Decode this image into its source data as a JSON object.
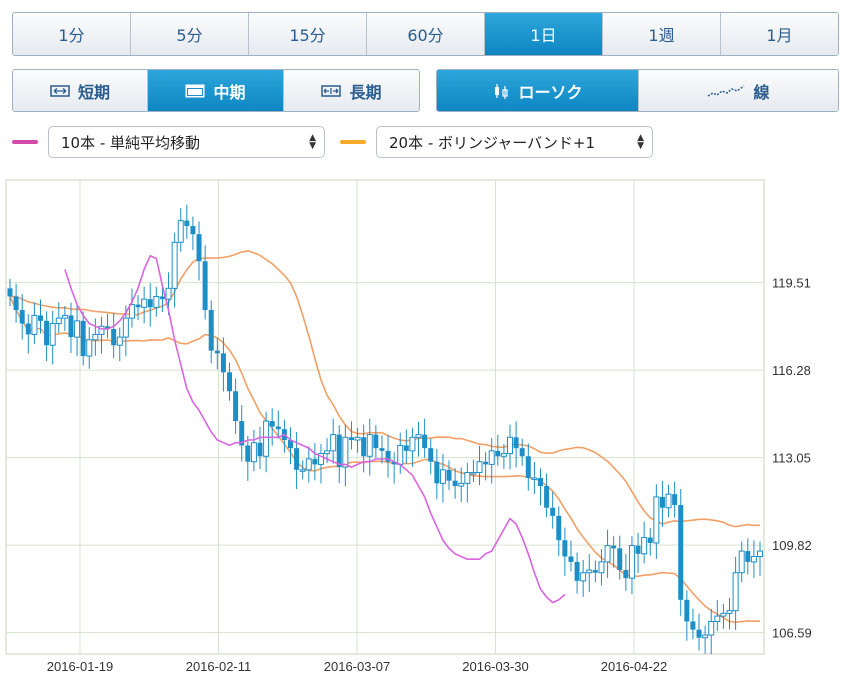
{
  "timeframes": [
    {
      "label": "1分",
      "active": false
    },
    {
      "label": "5分",
      "active": false
    },
    {
      "label": "15分",
      "active": false
    },
    {
      "label": "60分",
      "active": false
    },
    {
      "label": "1日",
      "active": true
    },
    {
      "label": "1週",
      "active": false
    },
    {
      "label": "1月",
      "active": false
    }
  ],
  "periods": [
    {
      "label": "短期",
      "icon": "arrows-span-icon",
      "active": false
    },
    {
      "label": "中期",
      "icon": "window-icon",
      "active": true
    },
    {
      "label": "長期",
      "icon": "arrows-wide-icon",
      "active": false
    }
  ],
  "chart_types": [
    {
      "label": "ローソク",
      "icon": "candlestick-icon",
      "active": true
    },
    {
      "label": "線",
      "icon": "line-chart-icon",
      "active": false
    }
  ],
  "indicators": [
    {
      "color": "#d14aa8",
      "selected": "10本 - 単純平均移動"
    },
    {
      "color": "#f7a928",
      "selected": "20本 - ボリンジャーバンド+1"
    }
  ],
  "colors": {
    "candle": "#1e8fc6",
    "sma": "#d965e0",
    "band": "#f2a066",
    "grid": "#d6e3ce",
    "axis_text": "#333333"
  },
  "chart_data": {
    "type": "candlestick",
    "x_tick_labels": [
      "2016-01-19",
      "2016-02-11",
      "2016-03-07",
      "2016-03-30",
      "2016-04-22"
    ],
    "y_tick_labels": [
      "119.51",
      "116.28",
      "113.05",
      "109.82",
      "106.59"
    ],
    "ylim": [
      105.8,
      123.3
    ],
    "grid": true,
    "candles_close": [
      119.0,
      118.5,
      118.0,
      117.6,
      118.3,
      118.1,
      117.2,
      118.0,
      118.2,
      118.3,
      117.5,
      118.1,
      116.8,
      117.4,
      117.6,
      117.9,
      117.8,
      117.2,
      117.5,
      118.2,
      118.7,
      118.6,
      118.9,
      118.6,
      119.0,
      118.9,
      119.3,
      121.0,
      121.8,
      121.6,
      121.3,
      120.3,
      118.5,
      117.0,
      116.9,
      116.2,
      115.5,
      114.4,
      113.5,
      112.9,
      113.6,
      113.1,
      114.4,
      114.2,
      114.1,
      113.7,
      113.4,
      112.6,
      112.6,
      113.0,
      112.8,
      113.2,
      113.3,
      113.9,
      112.7,
      113.8,
      113.7,
      113.8,
      113.1,
      113.9,
      113.4,
      113.3,
      112.9,
      112.8,
      113.5,
      113.3,
      113.8,
      113.9,
      113.4,
      112.9,
      112.1,
      112.6,
      112.2,
      112.0,
      112.1,
      112.5,
      112.5,
      112.9,
      112.8,
      113.3,
      113.1,
      113.2,
      113.8,
      113.4,
      113.1,
      112.3,
      112.3,
      112.0,
      111.2,
      110.9,
      110.0,
      109.4,
      109.2,
      108.5,
      108.8,
      108.9,
      108.8,
      109.2,
      109.8,
      109.7,
      108.9,
      108.6,
      109.8,
      109.5,
      110.1,
      109.9,
      111.6,
      111.2,
      111.7,
      111.3,
      107.8,
      107.0,
      106.7,
      106.4,
      106.5,
      107.0,
      107.2,
      107.3,
      107.4,
      108.8,
      109.6,
      109.2,
      109.4,
      109.6
    ],
    "sma_start_index": 9,
    "sma_values": [
      120.0,
      119.3,
      118.7,
      118.3,
      118.0,
      117.9,
      117.8,
      117.8,
      117.9,
      118.1,
      118.4,
      118.8,
      119.3,
      120.0,
      120.5,
      120.4,
      119.4,
      118.5,
      117.4,
      116.5,
      115.6,
      115.1,
      114.8,
      114.4,
      114.0,
      113.7,
      113.6,
      113.5,
      113.6,
      113.6,
      113.7,
      113.7,
      113.8,
      113.8,
      113.8,
      113.8,
      113.9,
      113.7,
      113.6,
      113.5,
      113.4,
      113.2,
      113.1,
      113.0,
      112.9,
      112.8,
      112.8,
      112.7,
      112.8,
      112.9,
      112.9,
      113.0,
      113.0,
      113.0,
      112.9,
      112.8,
      112.6,
      112.4,
      112.0,
      111.6,
      111.0,
      110.5,
      110.0,
      109.7,
      109.5,
      109.4,
      109.3,
      109.3,
      109.3,
      109.5,
      109.6,
      110.0,
      110.4,
      110.8,
      110.6,
      110.1,
      109.5,
      108.8,
      108.2,
      107.9,
      107.7,
      107.8,
      108.0
    ]
  }
}
